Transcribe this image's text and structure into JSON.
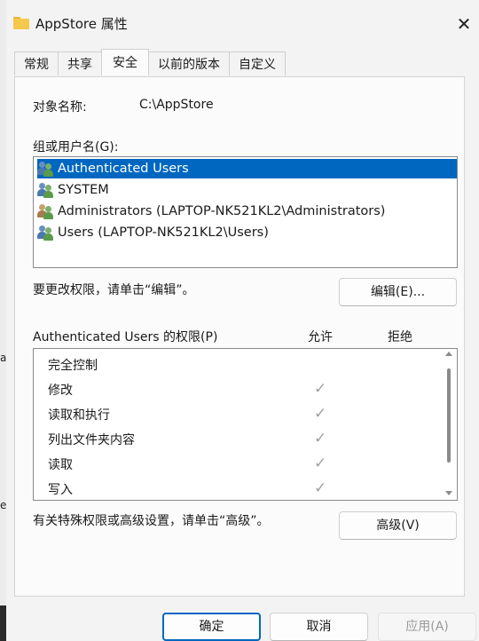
{
  "window": {
    "title": "AppStore 属性",
    "close_label": "✕"
  },
  "background": {
    "fragment_1": "a",
    "fragment_2": "e"
  },
  "tabs": [
    {
      "label": "常规",
      "active": false
    },
    {
      "label": "共享",
      "active": false
    },
    {
      "label": "安全",
      "active": true
    },
    {
      "label": "以前的版本",
      "active": false
    },
    {
      "label": "自定义",
      "active": false
    }
  ],
  "security": {
    "object_name_label": "对象名称:",
    "object_name_value": "C:\\AppStore",
    "group_label": "组或用户名(G):",
    "users": [
      {
        "name": "Authenticated Users",
        "icon": "users-group-icon",
        "selected": true
      },
      {
        "name": "SYSTEM",
        "icon": "users-group-icon",
        "selected": false
      },
      {
        "name": "Administrators (LAPTOP-NK521KL2\\Administrators)",
        "icon": "users-group-icon",
        "selected": false
      },
      {
        "name": "Users (LAPTOP-NK521KL2\\Users)",
        "icon": "users-group-icon",
        "selected": false
      }
    ],
    "edit_hint": "要更改权限，请单击“编辑”。",
    "edit_button": "编辑(E)...",
    "permissions_title": "Authenticated Users 的权限(P)",
    "allow_header": "允许",
    "deny_header": "拒绝",
    "permissions": [
      {
        "name": "完全控制",
        "allow": false,
        "deny": false
      },
      {
        "name": "修改",
        "allow": true,
        "deny": false
      },
      {
        "name": "读取和执行",
        "allow": true,
        "deny": false
      },
      {
        "name": "列出文件夹内容",
        "allow": true,
        "deny": false
      },
      {
        "name": "读取",
        "allow": true,
        "deny": false
      },
      {
        "name": "写入",
        "allow": true,
        "deny": false
      }
    ],
    "check_glyph": "✓",
    "advanced_hint": "有关特殊权限或高级设置，请单击“高级”。",
    "advanced_button": "高级(V)"
  },
  "footer": {
    "ok": "确定",
    "cancel": "取消",
    "apply": "应用(A)",
    "apply_enabled": false
  },
  "colors": {
    "accent": "#0067c0",
    "check": "#a0a0a0",
    "dialog_bg": "#f3f3f3"
  }
}
